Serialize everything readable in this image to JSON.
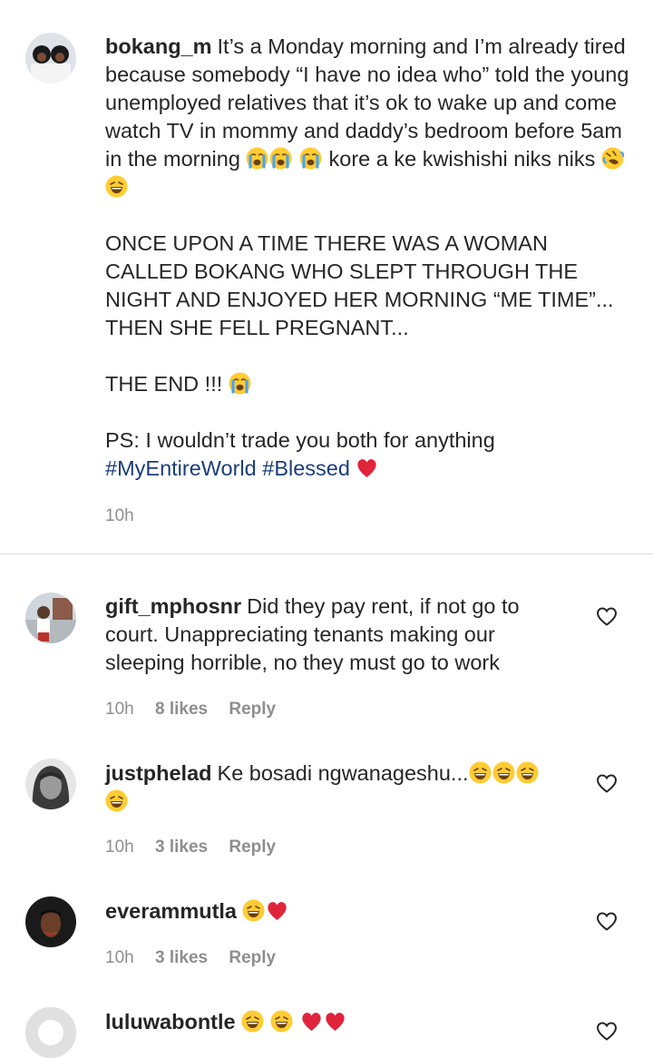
{
  "caption": {
    "username": "bokang_m",
    "p1_text": "It’s a Monday morning and I’m already tired because somebody “I have no idea who” told the young unemployed relatives that it’s ok to wake up and come watch TV in mommy and daddy’s bedroom before 5am in the morning",
    "p1_tail": "kore a ke kwishishi niks niks",
    "p2_text": "ONCE UPON A TIME THERE WAS A WOMAN CALLED BOKANG WHO SLEPT THROUGH THE NIGHT AND ENJOYED HER MORNING “ME TIME”... THEN SHE FELL PREGNANT...",
    "p3_text": "THE END !!!",
    "p4_text": "PS: I wouldn’t trade you both for anything",
    "hashtag1": "#MyEntireWorld",
    "hashtag2": "#Blessed",
    "time": "10h"
  },
  "comments": [
    {
      "username": "gift_mphosnr",
      "text": "Did they pay rent, if not go to court. Unappreciating tenants making our sleeping horrible, no they must go to work",
      "time": "10h",
      "likes": "8 likes",
      "reply": "Reply"
    },
    {
      "username": "justphelad",
      "text": "Ke bosadi ngwanageshu...",
      "time": "10h",
      "likes": "3 likes",
      "reply": "Reply"
    },
    {
      "username": "everammutla",
      "text": "",
      "time": "10h",
      "likes": "3 likes",
      "reply": "Reply"
    },
    {
      "username": "luluwabontle",
      "text": ""
    }
  ],
  "colors": {
    "text": "#262626",
    "secondary": "#8e8e8e",
    "hashtag": "#1b3c7a",
    "heart_emoji": "#e0243b",
    "emoji_yellow": "#ffcc33"
  }
}
